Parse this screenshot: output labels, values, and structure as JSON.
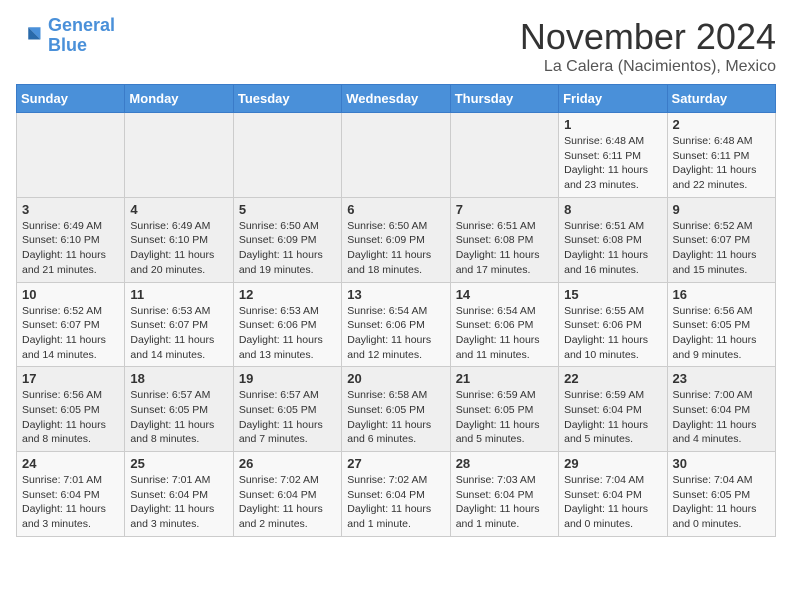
{
  "logo": {
    "line1": "General",
    "line2": "Blue"
  },
  "title": "November 2024",
  "location": "La Calera (Nacimientos), Mexico",
  "weekdays": [
    "Sunday",
    "Monday",
    "Tuesday",
    "Wednesday",
    "Thursday",
    "Friday",
    "Saturday"
  ],
  "weeks": [
    [
      {
        "day": "",
        "info": ""
      },
      {
        "day": "",
        "info": ""
      },
      {
        "day": "",
        "info": ""
      },
      {
        "day": "",
        "info": ""
      },
      {
        "day": "",
        "info": ""
      },
      {
        "day": "1",
        "info": "Sunrise: 6:48 AM\nSunset: 6:11 PM\nDaylight: 11 hours\nand 23 minutes."
      },
      {
        "day": "2",
        "info": "Sunrise: 6:48 AM\nSunset: 6:11 PM\nDaylight: 11 hours\nand 22 minutes."
      }
    ],
    [
      {
        "day": "3",
        "info": "Sunrise: 6:49 AM\nSunset: 6:10 PM\nDaylight: 11 hours\nand 21 minutes."
      },
      {
        "day": "4",
        "info": "Sunrise: 6:49 AM\nSunset: 6:10 PM\nDaylight: 11 hours\nand 20 minutes."
      },
      {
        "day": "5",
        "info": "Sunrise: 6:50 AM\nSunset: 6:09 PM\nDaylight: 11 hours\nand 19 minutes."
      },
      {
        "day": "6",
        "info": "Sunrise: 6:50 AM\nSunset: 6:09 PM\nDaylight: 11 hours\nand 18 minutes."
      },
      {
        "day": "7",
        "info": "Sunrise: 6:51 AM\nSunset: 6:08 PM\nDaylight: 11 hours\nand 17 minutes."
      },
      {
        "day": "8",
        "info": "Sunrise: 6:51 AM\nSunset: 6:08 PM\nDaylight: 11 hours\nand 16 minutes."
      },
      {
        "day": "9",
        "info": "Sunrise: 6:52 AM\nSunset: 6:07 PM\nDaylight: 11 hours\nand 15 minutes."
      }
    ],
    [
      {
        "day": "10",
        "info": "Sunrise: 6:52 AM\nSunset: 6:07 PM\nDaylight: 11 hours\nand 14 minutes."
      },
      {
        "day": "11",
        "info": "Sunrise: 6:53 AM\nSunset: 6:07 PM\nDaylight: 11 hours\nand 14 minutes."
      },
      {
        "day": "12",
        "info": "Sunrise: 6:53 AM\nSunset: 6:06 PM\nDaylight: 11 hours\nand 13 minutes."
      },
      {
        "day": "13",
        "info": "Sunrise: 6:54 AM\nSunset: 6:06 PM\nDaylight: 11 hours\nand 12 minutes."
      },
      {
        "day": "14",
        "info": "Sunrise: 6:54 AM\nSunset: 6:06 PM\nDaylight: 11 hours\nand 11 minutes."
      },
      {
        "day": "15",
        "info": "Sunrise: 6:55 AM\nSunset: 6:06 PM\nDaylight: 11 hours\nand 10 minutes."
      },
      {
        "day": "16",
        "info": "Sunrise: 6:56 AM\nSunset: 6:05 PM\nDaylight: 11 hours\nand 9 minutes."
      }
    ],
    [
      {
        "day": "17",
        "info": "Sunrise: 6:56 AM\nSunset: 6:05 PM\nDaylight: 11 hours\nand 8 minutes."
      },
      {
        "day": "18",
        "info": "Sunrise: 6:57 AM\nSunset: 6:05 PM\nDaylight: 11 hours\nand 8 minutes."
      },
      {
        "day": "19",
        "info": "Sunrise: 6:57 AM\nSunset: 6:05 PM\nDaylight: 11 hours\nand 7 minutes."
      },
      {
        "day": "20",
        "info": "Sunrise: 6:58 AM\nSunset: 6:05 PM\nDaylight: 11 hours\nand 6 minutes."
      },
      {
        "day": "21",
        "info": "Sunrise: 6:59 AM\nSunset: 6:05 PM\nDaylight: 11 hours\nand 5 minutes."
      },
      {
        "day": "22",
        "info": "Sunrise: 6:59 AM\nSunset: 6:04 PM\nDaylight: 11 hours\nand 5 minutes."
      },
      {
        "day": "23",
        "info": "Sunrise: 7:00 AM\nSunset: 6:04 PM\nDaylight: 11 hours\nand 4 minutes."
      }
    ],
    [
      {
        "day": "24",
        "info": "Sunrise: 7:01 AM\nSunset: 6:04 PM\nDaylight: 11 hours\nand 3 minutes."
      },
      {
        "day": "25",
        "info": "Sunrise: 7:01 AM\nSunset: 6:04 PM\nDaylight: 11 hours\nand 3 minutes."
      },
      {
        "day": "26",
        "info": "Sunrise: 7:02 AM\nSunset: 6:04 PM\nDaylight: 11 hours\nand 2 minutes."
      },
      {
        "day": "27",
        "info": "Sunrise: 7:02 AM\nSunset: 6:04 PM\nDaylight: 11 hours\nand 1 minute."
      },
      {
        "day": "28",
        "info": "Sunrise: 7:03 AM\nSunset: 6:04 PM\nDaylight: 11 hours\nand 1 minute."
      },
      {
        "day": "29",
        "info": "Sunrise: 7:04 AM\nSunset: 6:04 PM\nDaylight: 11 hours\nand 0 minutes."
      },
      {
        "day": "30",
        "info": "Sunrise: 7:04 AM\nSunset: 6:05 PM\nDaylight: 11 hours\nand 0 minutes."
      }
    ]
  ]
}
